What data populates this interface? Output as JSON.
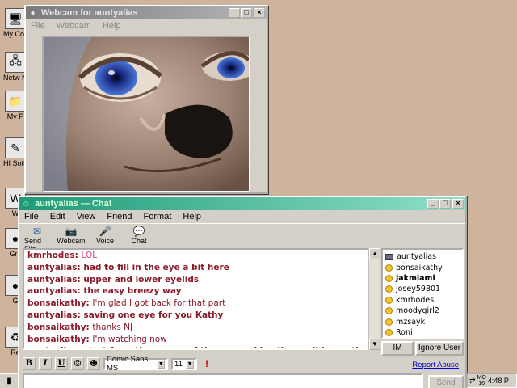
{
  "desktop_icons": [
    {
      "label": "My Comp",
      "icon": "computer-icon",
      "glyph": "🖥"
    },
    {
      "label": "Netw Neigh",
      "icon": "network-icon",
      "glyph": "🖧"
    },
    {
      "label": "My P",
      "icon": "folder-icon",
      "glyph": "📁"
    },
    {
      "label": "HI Softw",
      "icon": "software-icon",
      "glyph": "✎"
    },
    {
      "label": "W",
      "icon": "app-icon",
      "glyph": "W"
    },
    {
      "label": "Gra",
      "icon": "app-icon",
      "glyph": "●"
    },
    {
      "label": "G",
      "icon": "app-icon",
      "glyph": "●"
    },
    {
      "label": "Re",
      "icon": "recycle-bin-icon",
      "glyph": "♻"
    }
  ],
  "webcam_window": {
    "title": "Webcam for auntyalias",
    "menu": [
      "File",
      "Webcam",
      "Help"
    ],
    "buttons": {
      "minimize": "_",
      "maximize": "□",
      "close": "×"
    }
  },
  "chat_window": {
    "title": "auntyalias — Chat",
    "menu": [
      "File",
      "Edit",
      "View",
      "Friend",
      "Format",
      "Help"
    ],
    "toolbar": [
      {
        "label": "Send File",
        "icon": "send-file-icon",
        "glyph": "✉"
      },
      {
        "label": "Webcam",
        "icon": "webcam-icon",
        "glyph": "📷"
      },
      {
        "label": "Voice",
        "icon": "voice-icon",
        "glyph": "🎤"
      },
      {
        "label": "Chat",
        "icon": "chat-icon",
        "glyph": "💬"
      }
    ],
    "messages": [
      {
        "who": "kmrhodes:",
        "text": "LOL",
        "style": "lol"
      },
      {
        "who": "auntyalias:",
        "text": "had to fill in the eye a bit here",
        "style": "bold"
      },
      {
        "who": "auntyalias:",
        "text": "upper and lower eyelids",
        "style": "bold"
      },
      {
        "who": "auntyalias:",
        "text": "the easy breezy way",
        "style": "bold"
      },
      {
        "who": "bonsaikathy:",
        "text": "I'm glad I got back for that part",
        "style": "plain"
      },
      {
        "who": "auntyalias:",
        "text": "saving one eye for you Kathy",
        "style": "bold"
      },
      {
        "who": "bonsaikathy:",
        "text": "thanks NJ",
        "style": "plain"
      },
      {
        "who": "bonsaikathy:",
        "text": "I'm watching now",
        "style": "plain"
      },
      {
        "who": "auntyalias:",
        "text": "start from the corner of the eye and lay the eyelid over the eyeball",
        "style": "bold"
      }
    ],
    "buddies": [
      {
        "name": "auntyalias",
        "kind": "cam",
        "bold": false
      },
      {
        "name": "bonsaikathy",
        "kind": "face",
        "bold": false
      },
      {
        "name": "jakmiami",
        "kind": "face",
        "bold": true
      },
      {
        "name": "josey59801",
        "kind": "face",
        "bold": false
      },
      {
        "name": "kmrhodes",
        "kind": "face",
        "bold": false
      },
      {
        "name": "moodygirl2",
        "kind": "face",
        "bold": false
      },
      {
        "name": "mzsayk",
        "kind": "face",
        "bold": false
      },
      {
        "name": "Roni",
        "kind": "face",
        "bold": false
      }
    ],
    "im_button": "IM",
    "ignore_button": "Ignore User",
    "format": {
      "bold": "B",
      "italic": "I",
      "underline": "U",
      "font": "Comic Sans MS",
      "size": "11"
    },
    "report_abuse": "Report Abuse",
    "send_button": "Send"
  },
  "tray": {
    "day_top": "MO",
    "day_num": "16",
    "time": "4:48 P"
  },
  "colors": {
    "desktop": "#ceb49c",
    "chat_title": "#1e9a78",
    "message": "#8b1a2a",
    "lol": "#d94080"
  }
}
